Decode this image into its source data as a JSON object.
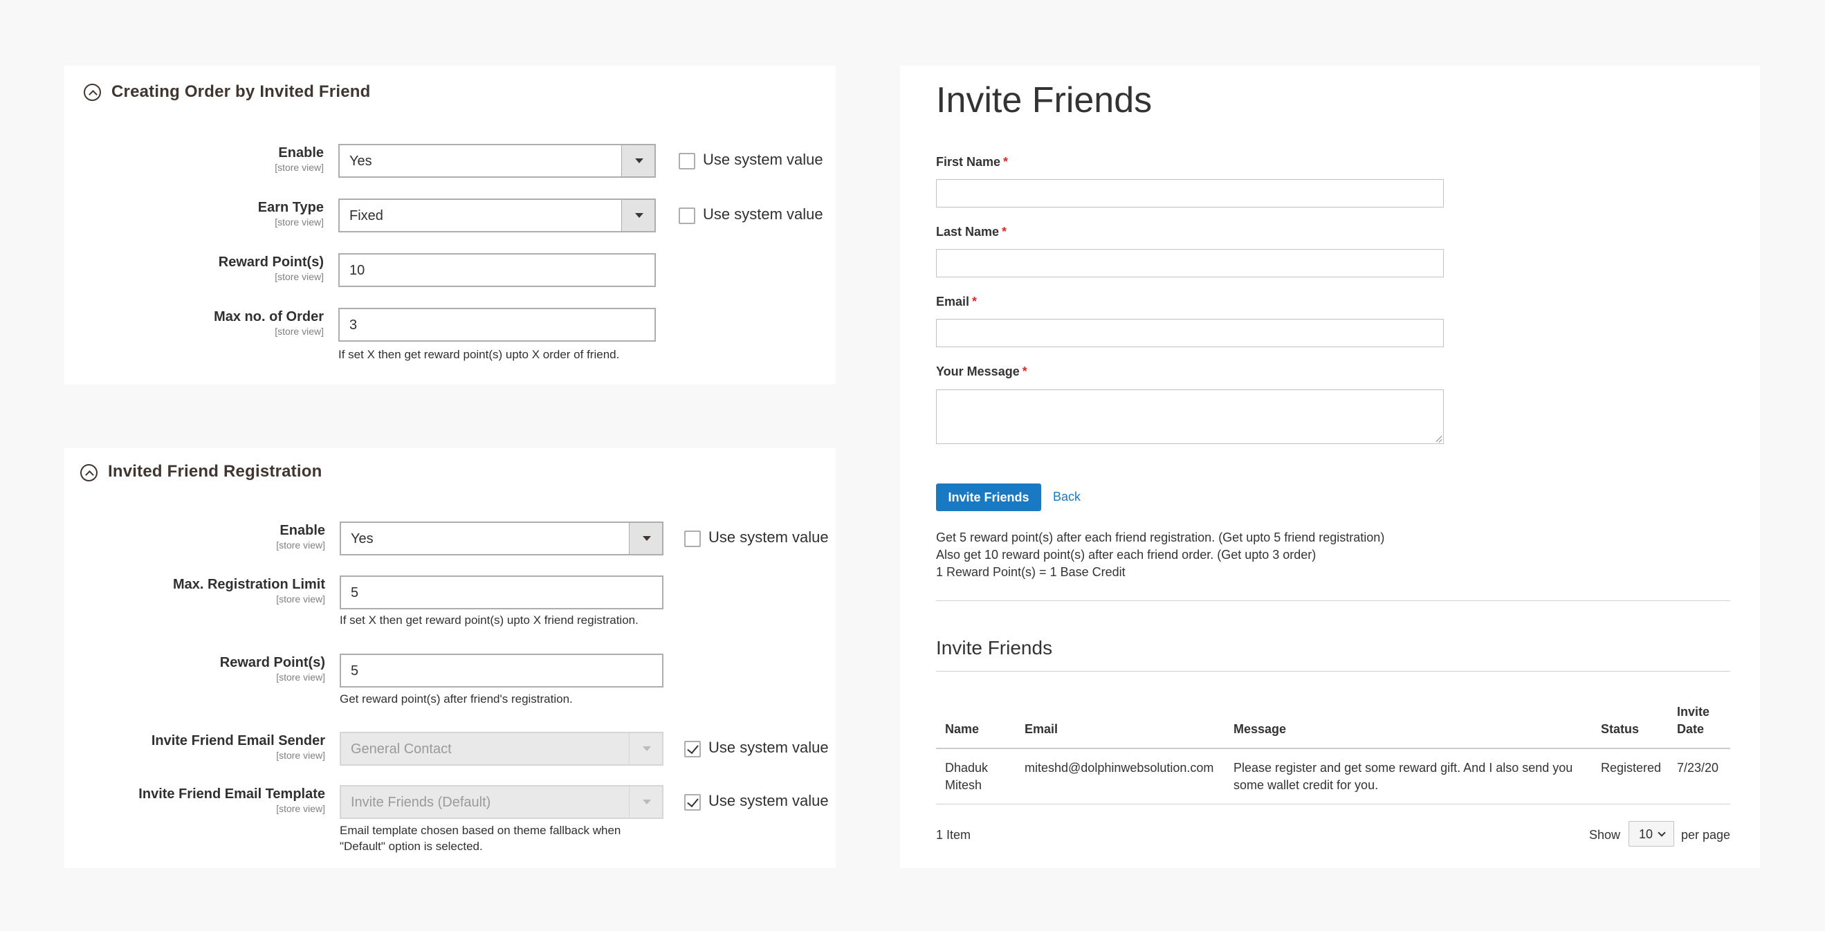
{
  "order_section": {
    "title": "Creating Order by Invited Friend",
    "enable": {
      "label": "Enable",
      "scope": "[store view]",
      "value": "Yes",
      "use_system": "Use system value"
    },
    "earn_type": {
      "label": "Earn Type",
      "scope": "[store view]",
      "value": "Fixed",
      "use_system": "Use system value"
    },
    "reward_points": {
      "label": "Reward Point(s)",
      "scope": "[store view]",
      "value": "10"
    },
    "max_order": {
      "label": "Max no. of Order",
      "scope": "[store view]",
      "value": "3",
      "note": "If set X then get reward point(s) upto X order of friend."
    }
  },
  "registration_section": {
    "title": "Invited Friend Registration",
    "enable": {
      "label": "Enable",
      "scope": "[store view]",
      "value": "Yes",
      "use_system": "Use system value"
    },
    "max_registration": {
      "label": "Max. Registration Limit",
      "scope": "[store view]",
      "value": "5",
      "note": "If set X then get reward point(s) upto X friend registration."
    },
    "reward_points": {
      "label": "Reward Point(s)",
      "scope": "[store view]",
      "value": "5",
      "note": "Get reward point(s) after friend's registration."
    },
    "email_sender": {
      "label": "Invite Friend Email Sender",
      "scope": "[store view]",
      "value": "General Contact",
      "use_system": "Use system value"
    },
    "email_template": {
      "label": "Invite Friend Email Template",
      "scope": "[store view]",
      "value": "Invite Friends (Default)",
      "use_system": "Use system value",
      "note_line1": "Email template chosen based on theme fallback when",
      "note_line2": "\"Default\" option is selected."
    }
  },
  "invite_form": {
    "title": "Invite Friends",
    "required_mark": "*",
    "first_name_label": "First Name",
    "last_name_label": "Last Name",
    "email_label": "Email",
    "message_label": "Your Message",
    "submit_label": "Invite Friends",
    "back_label": "Back",
    "info": [
      "Get 5 reward point(s) after each friend registration. (Get upto 5 friend registration)",
      "Also get 10 reward point(s) after each friend order. (Get upto 3 order)",
      "1 Reward Point(s) = 1 Base Credit"
    ]
  },
  "invites_table": {
    "title": "Invite Friends",
    "headers": {
      "name": "Name",
      "email": "Email",
      "message": "Message",
      "status": "Status",
      "date_line1": "Invite",
      "date_line2": "Date"
    },
    "rows": [
      {
        "name_line1": "Dhaduk",
        "name_line2": "Mitesh",
        "email": "miteshd@dolphinwebsolution.com",
        "message_line1": "Please register and get some reward gift. And I also send you",
        "message_line2": "some wallet credit for you.",
        "status": "Registered",
        "date": "7/23/20"
      }
    ],
    "item_count": "1 Item",
    "show_label": "Show",
    "per_page_value": "10",
    "per_page_label": "per page"
  }
}
